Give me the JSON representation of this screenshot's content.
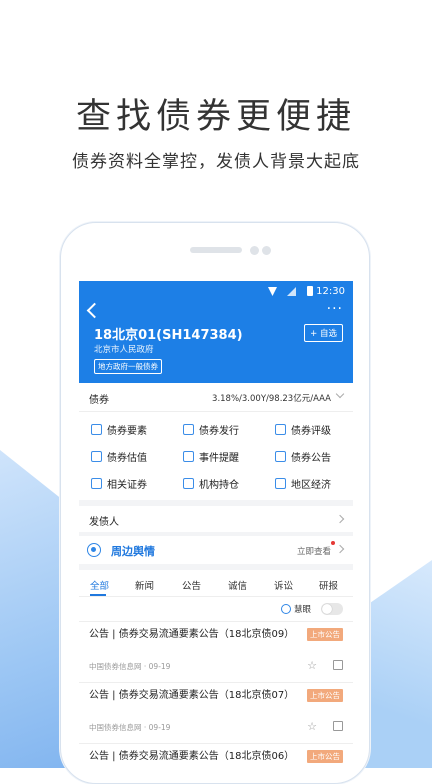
{
  "promo": {
    "headline": "查找债券更便捷",
    "subhead": "债券资料全掌控，发债人背景大起底"
  },
  "status_bar": {
    "time": "12:30"
  },
  "header": {
    "bond_name": "18北京01(SH147384)",
    "issuer": "北京市人民政府",
    "tag": "地方政府一般债券",
    "add_label": "+ 自选",
    "more_label": "···"
  },
  "bond_row": {
    "label": "债券",
    "value": "3.18%/3.00Y/98.23亿元/AAA"
  },
  "grid": [
    {
      "label": "债券要素",
      "icon": "document-icon"
    },
    {
      "label": "债券发行",
      "icon": "issue-icon"
    },
    {
      "label": "债券评级",
      "icon": "rating-icon"
    },
    {
      "label": "债券估值",
      "icon": "valuation-icon"
    },
    {
      "label": "事件提醒",
      "icon": "reminder-icon"
    },
    {
      "label": "债券公告",
      "icon": "announcement-icon"
    },
    {
      "label": "相关证券",
      "icon": "securities-icon"
    },
    {
      "label": "机构持仓",
      "icon": "holdings-icon"
    },
    {
      "label": "地区经济",
      "icon": "region-icon"
    }
  ],
  "issuer_row": {
    "label": "发债人"
  },
  "news": {
    "title": "周边舆情",
    "link": "立即查看"
  },
  "tabs": [
    "全部",
    "新闻",
    "公告",
    "诚信",
    "诉讼",
    "研报"
  ],
  "filter": {
    "label": "慧眼"
  },
  "items": [
    {
      "title": "公告 | 债券交易流通要素公告（18北京债09）",
      "meta": "中国债券信息网 · 09-19",
      "badge": "上市公告"
    },
    {
      "title": "公告 | 债券交易流通要素公告（18北京债07）",
      "meta": "中国债券信息网 · 09-19",
      "badge": "上市公告"
    },
    {
      "title": "公告 | 债券交易流通要素公告（18北京债06）",
      "meta": "",
      "badge": "上市公告"
    }
  ],
  "colors": {
    "accent": "#1d7fe6",
    "badge": "#f2a97c"
  }
}
